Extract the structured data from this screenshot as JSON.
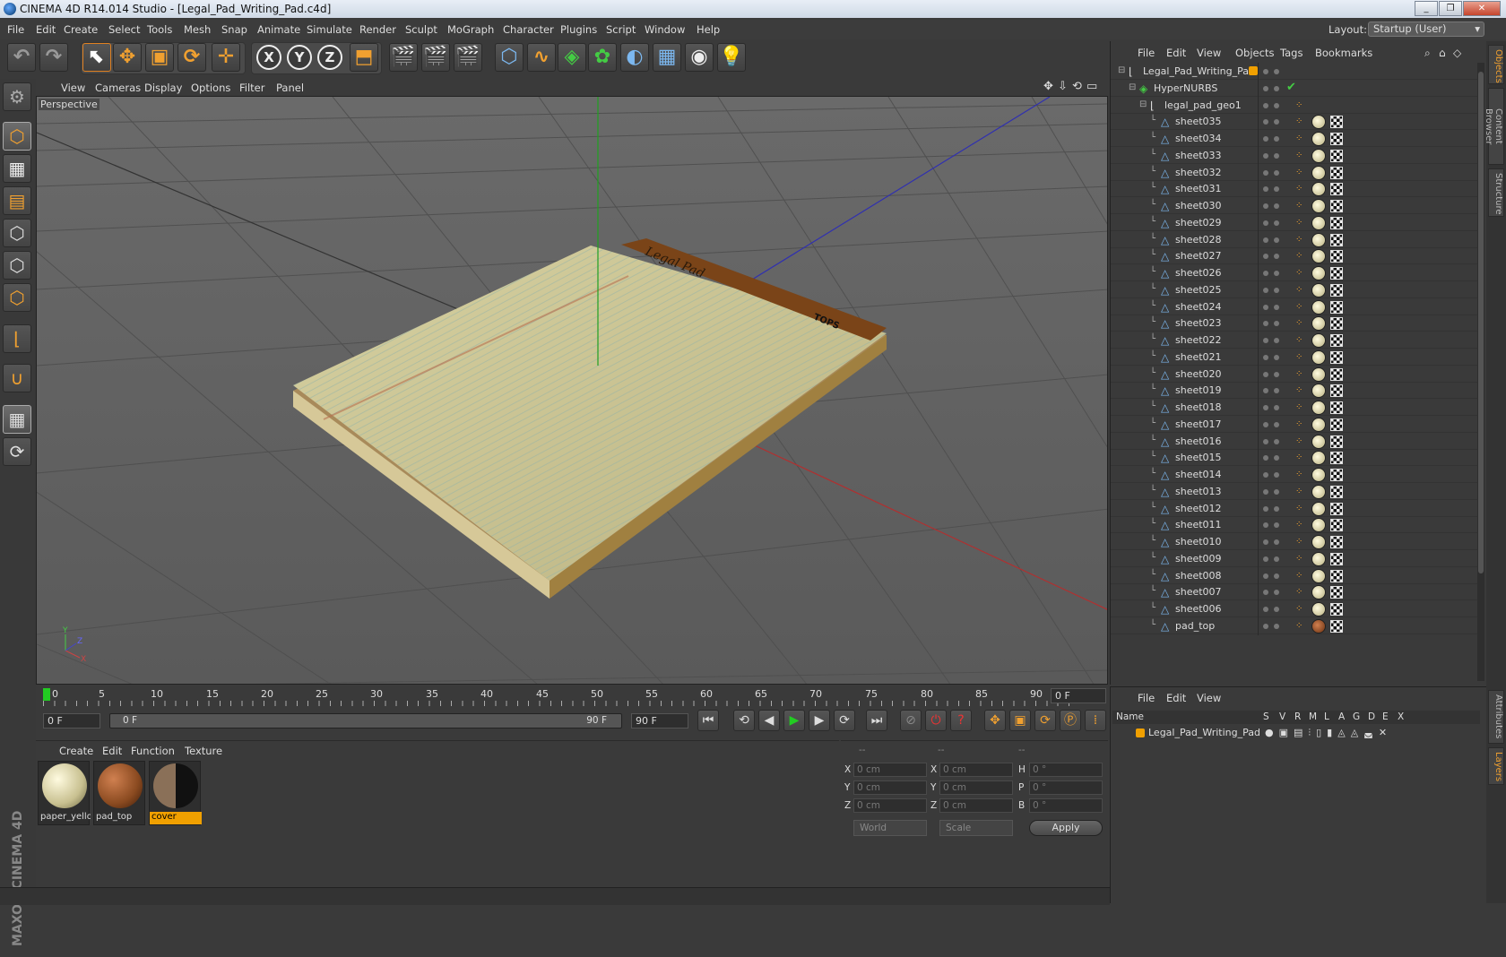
{
  "window": {
    "title": "CINEMA 4D R14.014 Studio - [Legal_Pad_Writing_Pad.c4d]"
  },
  "menu": [
    "File",
    "Edit",
    "Create",
    "Select",
    "Tools",
    "Mesh",
    "Snap",
    "Animate",
    "Simulate",
    "Render",
    "Sculpt",
    "MoGraph",
    "Character",
    "Plugins",
    "Script",
    "Window",
    "Help"
  ],
  "layout": {
    "label": "Layout:",
    "value": "Startup (User)"
  },
  "viewport": {
    "menu": [
      "View",
      "Cameras",
      "Display",
      "Options",
      "Filter",
      "Panel"
    ],
    "label": "Perspective",
    "pad_text": "Legal Pad",
    "brand_text": "TOPS"
  },
  "timeline": {
    "ticks": [
      "0",
      "5",
      "10",
      "15",
      "20",
      "25",
      "30",
      "35",
      "40",
      "45",
      "50",
      "55",
      "60",
      "65",
      "70",
      "75",
      "80",
      "85",
      "90"
    ],
    "current_frame_field": "0 F",
    "start_field": "0 F",
    "range_start": "0 F",
    "range_end": "90 F",
    "end_field": "90 F"
  },
  "materials": {
    "menu": [
      "Create",
      "Edit",
      "Function",
      "Texture"
    ],
    "items": [
      {
        "name": "paper_yello",
        "color": "#e8e2b0"
      },
      {
        "name": "pad_top",
        "color": "#8a4a20"
      },
      {
        "name": "cover",
        "color": "#3a2a1a"
      }
    ]
  },
  "coords": {
    "header": [
      "--",
      "--",
      "--"
    ],
    "rows": [
      {
        "a": "X",
        "av": "0 cm",
        "b": "X",
        "bv": "0 cm",
        "c": "H",
        "cv": "0 °"
      },
      {
        "a": "Y",
        "av": "0 cm",
        "b": "Y",
        "bv": "0 cm",
        "c": "P",
        "cv": "0 °"
      },
      {
        "a": "Z",
        "av": "0 cm",
        "b": "Z",
        "bv": "0 cm",
        "c": "B",
        "cv": "0 °"
      }
    ],
    "mode1": "World",
    "mode2": "Scale",
    "apply": "Apply"
  },
  "objects": {
    "menu": [
      "File",
      "Edit",
      "View",
      "Objects",
      "Tags",
      "Bookmarks"
    ],
    "root": "Legal_Pad_Writing_Pad",
    "hypernurbs": "HyperNURBS",
    "geo": "legal_pad_geo1",
    "sheets": [
      "sheet035",
      "sheet034",
      "sheet033",
      "sheet032",
      "sheet031",
      "sheet030",
      "sheet029",
      "sheet028",
      "sheet027",
      "sheet026",
      "sheet025",
      "sheet024",
      "sheet023",
      "sheet022",
      "sheet021",
      "sheet020",
      "sheet019",
      "sheet018",
      "sheet017",
      "sheet016",
      "sheet015",
      "sheet014",
      "sheet013",
      "sheet012",
      "sheet011",
      "sheet010",
      "sheet009",
      "sheet008",
      "sheet007",
      "sheet006",
      "pad_top"
    ]
  },
  "layers": {
    "menu": [
      "File",
      "Edit",
      "View"
    ],
    "columns": [
      "Name",
      "S",
      "V",
      "R",
      "M",
      "L",
      "A",
      "G",
      "D",
      "E",
      "X"
    ],
    "row": "Legal_Pad_Writing_Pad"
  },
  "right_tabs": [
    "Objects",
    "Content Browser",
    "Structure",
    "Attributes",
    "Layers"
  ],
  "brand": "MAXON CINEMA 4D"
}
